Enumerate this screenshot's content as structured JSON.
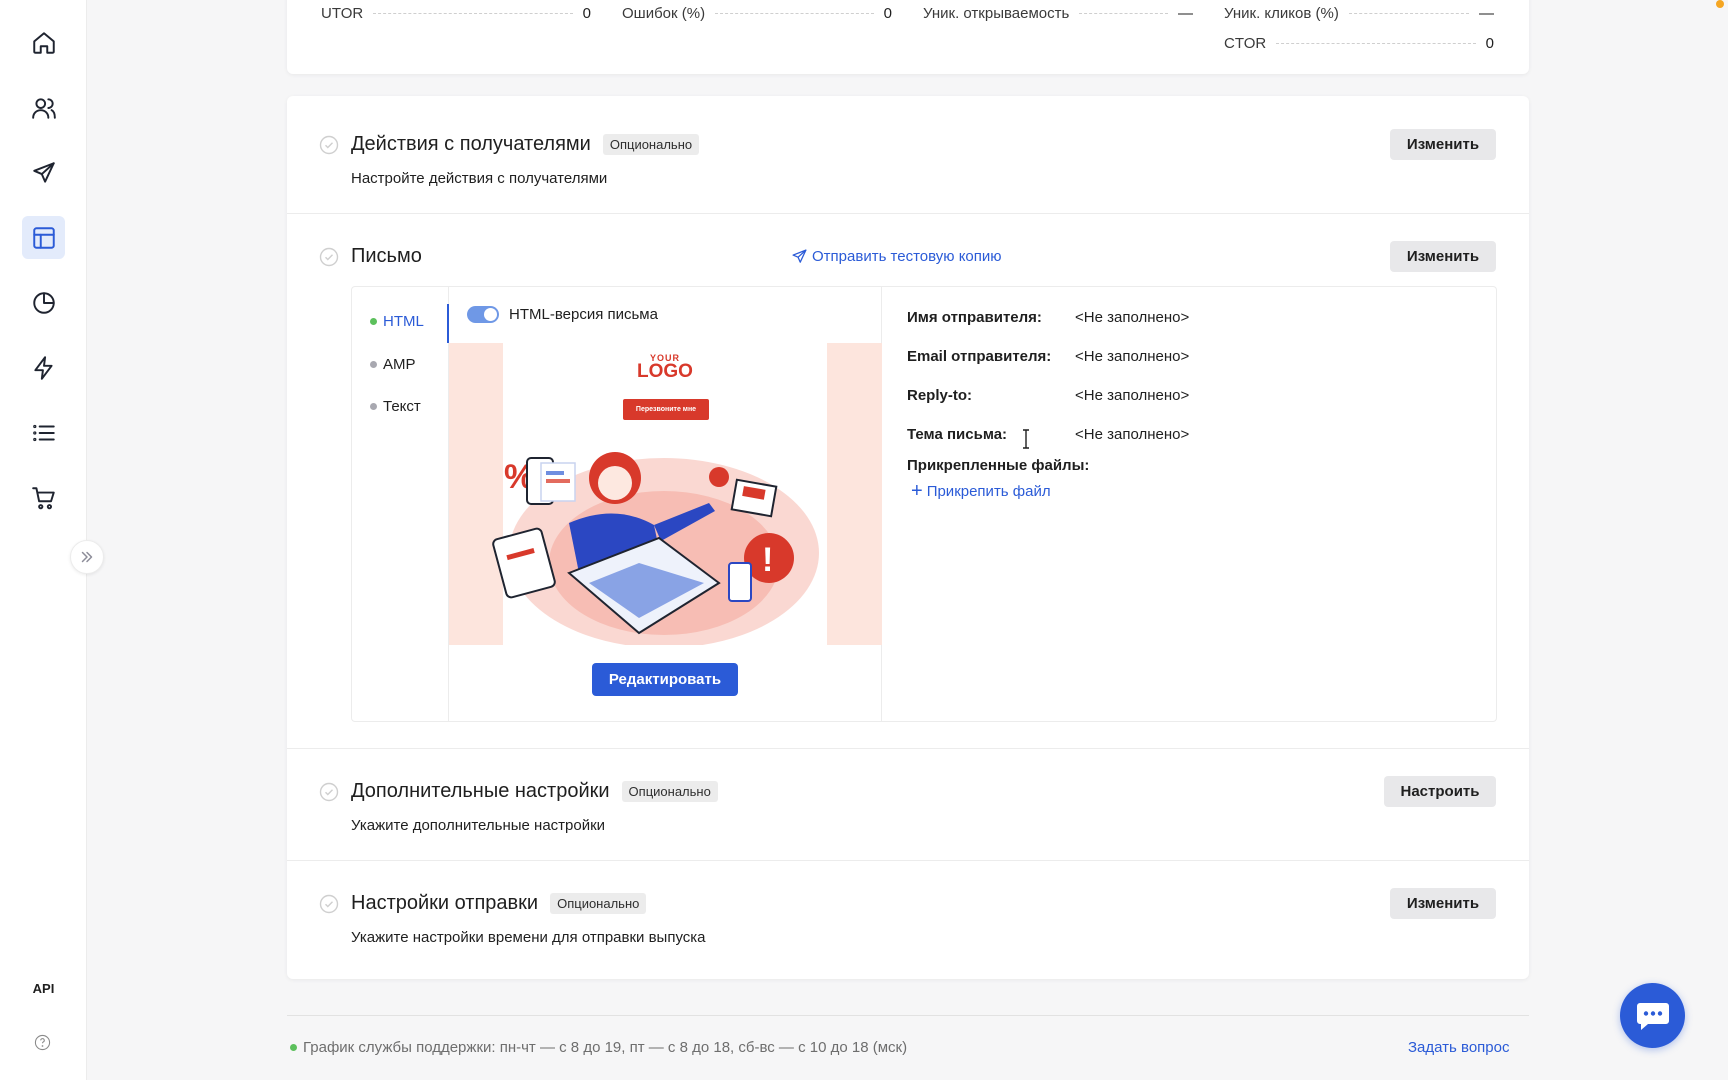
{
  "sidebar": {
    "items": [
      {
        "name": "home",
        "icon": "home-icon"
      },
      {
        "name": "contacts",
        "icon": "users-icon"
      },
      {
        "name": "campaigns",
        "icon": "send-icon"
      },
      {
        "name": "templates",
        "icon": "layout-icon",
        "active": true
      },
      {
        "name": "analytics",
        "icon": "pie-chart-icon"
      },
      {
        "name": "automation",
        "icon": "lightning-icon"
      },
      {
        "name": "lists",
        "icon": "list-icon"
      },
      {
        "name": "ecommerce",
        "icon": "cart-icon"
      }
    ],
    "api_label": "API"
  },
  "stats": {
    "utor_label": "UTOR",
    "utor_value": "0",
    "errors_label": "Ошибок (%)",
    "errors_value": "0",
    "unique_open_label": "Уник. открываемость",
    "unique_open_value": "—",
    "unique_clicks_label": "Уник. кликов (%)",
    "unique_clicks_value": "—",
    "ctor_label": "CTOR",
    "ctor_value": "0"
  },
  "sections": {
    "recipients": {
      "title": "Действия с получателями",
      "badge": "Опционально",
      "subtitle": "Настройте действия с получателями",
      "button": "Изменить"
    },
    "letter": {
      "title": "Письмо",
      "test_link": "Отправить тестовую копию",
      "button": "Изменить",
      "tabs": [
        "HTML",
        "AMP",
        "Текст"
      ],
      "toggle_label": "HTML-версия письма",
      "preview_logo_small": "YOUR",
      "preview_logo_big": "LOGO",
      "preview_button": "Перезвоните мне",
      "edit_button": "Редактировать",
      "fields": [
        {
          "label": "Имя отправителя:",
          "value": "<Не заполнено>"
        },
        {
          "label": "Email отправителя:",
          "value": "<Не заполнено>"
        },
        {
          "label": "Reply-to:",
          "value": "<Не заполнено>"
        },
        {
          "label": "Тема письма:",
          "value": "<Не заполнено>"
        }
      ],
      "attachments_label": "Прикрепленные файлы:",
      "attach_link": "Прикрепить файл"
    },
    "additional": {
      "title": "Дополнительные настройки",
      "badge": "Опционально",
      "subtitle": "Укажите дополнительные настройки",
      "button": "Настроить"
    },
    "sending": {
      "title": "Настройки отправки",
      "badge": "Опционально",
      "subtitle": "Укажите настройки времени для отправки выпуска",
      "button": "Изменить"
    }
  },
  "footer": {
    "support_hours": "График службы поддержки: пн-чт — с 8 до 19, пт — с 8 до 18, сб-вс — с 10 до 18 (мск)",
    "ask_link": "Задать вопрос"
  },
  "colors": {
    "accent": "#2b5bd7",
    "active_nav_bg": "#e3ebfb",
    "online": "#5cc05c",
    "brand_red": "#d8392b"
  }
}
